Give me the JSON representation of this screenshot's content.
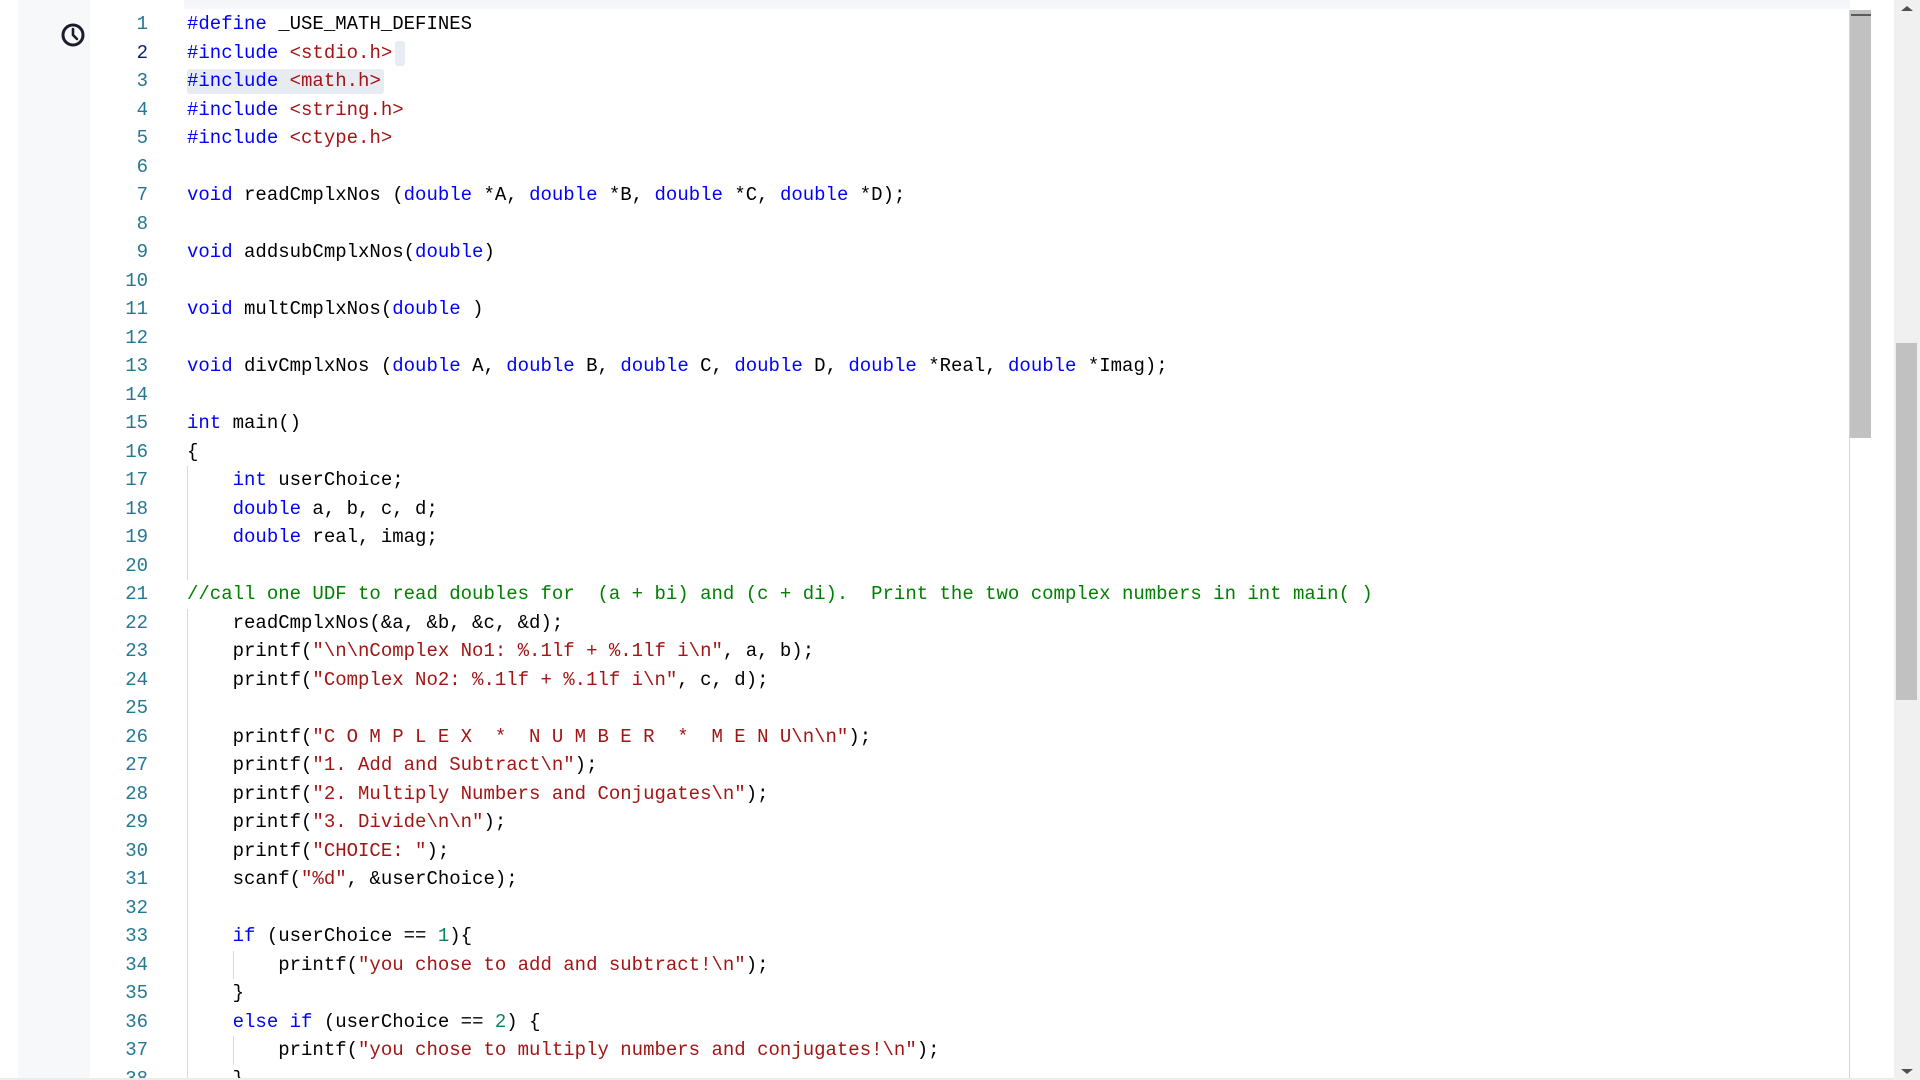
{
  "sidebar": {
    "icon": "clock-icon"
  },
  "editor": {
    "active_line": 2,
    "highlighted_line": 3,
    "colors": {
      "keyword": "#0000ff",
      "string": "#a31515",
      "comment": "#008000",
      "number": "#098658",
      "line_number": "#237893"
    },
    "lines": [
      [
        [
          "k",
          "#define"
        ],
        [
          "p",
          " _USE_MATH_DEFINES"
        ]
      ],
      [
        [
          "k",
          "#include"
        ],
        [
          "p",
          " "
        ],
        [
          "s",
          "<stdio.h>"
        ]
      ],
      [
        [
          "k",
          "#include"
        ],
        [
          "p",
          " "
        ],
        [
          "s",
          "<math.h>"
        ]
      ],
      [
        [
          "k",
          "#include"
        ],
        [
          "p",
          " "
        ],
        [
          "s",
          "<string.h>"
        ]
      ],
      [
        [
          "k",
          "#include"
        ],
        [
          "p",
          " "
        ],
        [
          "s",
          "<ctype.h>"
        ]
      ],
      [],
      [
        [
          "k",
          "void"
        ],
        [
          "p",
          " readCmplxNos ("
        ],
        [
          "k",
          "double"
        ],
        [
          "p",
          " *A, "
        ],
        [
          "k",
          "double"
        ],
        [
          "p",
          " *B, "
        ],
        [
          "k",
          "double"
        ],
        [
          "p",
          " *C, "
        ],
        [
          "k",
          "double"
        ],
        [
          "p",
          " *D);"
        ]
      ],
      [],
      [
        [
          "k",
          "void"
        ],
        [
          "p",
          " addsubCmplxNos("
        ],
        [
          "k",
          "double"
        ],
        [
          "p",
          ")"
        ]
      ],
      [],
      [
        [
          "k",
          "void"
        ],
        [
          "p",
          " multCmplxNos("
        ],
        [
          "k",
          "double"
        ],
        [
          "p",
          " )"
        ]
      ],
      [],
      [
        [
          "k",
          "void"
        ],
        [
          "p",
          " divCmplxNos ("
        ],
        [
          "k",
          "double"
        ],
        [
          "p",
          " A, "
        ],
        [
          "k",
          "double"
        ],
        [
          "p",
          " B, "
        ],
        [
          "k",
          "double"
        ],
        [
          "p",
          " C, "
        ],
        [
          "k",
          "double"
        ],
        [
          "p",
          " D, "
        ],
        [
          "k",
          "double"
        ],
        [
          "p",
          " *Real, "
        ],
        [
          "k",
          "double"
        ],
        [
          "p",
          " *Imag);"
        ]
      ],
      [],
      [
        [
          "k",
          "int"
        ],
        [
          "p",
          " main()"
        ]
      ],
      [
        [
          "p",
          "{"
        ]
      ],
      [
        [
          "p",
          "    "
        ],
        [
          "k",
          "int"
        ],
        [
          "p",
          " userChoice;"
        ]
      ],
      [
        [
          "p",
          "    "
        ],
        [
          "k",
          "double"
        ],
        [
          "p",
          " a, b, c, d;"
        ]
      ],
      [
        [
          "p",
          "    "
        ],
        [
          "k",
          "double"
        ],
        [
          "p",
          " real, imag;"
        ]
      ],
      [],
      [
        [
          "c",
          "//call one UDF to read doubles for  (a + bi) and (c + di).  Print the two complex numbers in int main( )"
        ]
      ],
      [
        [
          "p",
          "    readCmplxNos(&a, &b, &c, &d);"
        ]
      ],
      [
        [
          "p",
          "    printf("
        ],
        [
          "s",
          "\"\\n\\nComplex No1: %.1lf + %.1lf i\\n\""
        ],
        [
          "p",
          ", a, b);"
        ]
      ],
      [
        [
          "p",
          "    printf("
        ],
        [
          "s",
          "\"Complex No2: %.1lf + %.1lf i\\n\""
        ],
        [
          "p",
          ", c, d);"
        ]
      ],
      [],
      [
        [
          "p",
          "    printf("
        ],
        [
          "s",
          "\"C O M P L E X  *  N U M B E R  *  M E N U\\n\\n\""
        ],
        [
          "p",
          ");"
        ]
      ],
      [
        [
          "p",
          "    printf("
        ],
        [
          "s",
          "\"1. Add and Subtract\\n\""
        ],
        [
          "p",
          ");"
        ]
      ],
      [
        [
          "p",
          "    printf("
        ],
        [
          "s",
          "\"2. Multiply Numbers and Conjugates\\n\""
        ],
        [
          "p",
          ");"
        ]
      ],
      [
        [
          "p",
          "    printf("
        ],
        [
          "s",
          "\"3. Divide\\n\\n\""
        ],
        [
          "p",
          ");"
        ]
      ],
      [
        [
          "p",
          "    printf("
        ],
        [
          "s",
          "\"CHOICE: \""
        ],
        [
          "p",
          ");"
        ]
      ],
      [
        [
          "p",
          "    scanf("
        ],
        [
          "s",
          "\"%d\""
        ],
        [
          "p",
          ", &userChoice);"
        ]
      ],
      [],
      [
        [
          "p",
          "    "
        ],
        [
          "k",
          "if"
        ],
        [
          "p",
          " (userChoice == "
        ],
        [
          "n",
          "1"
        ],
        [
          "p",
          "){"
        ]
      ],
      [
        [
          "p",
          "        printf("
        ],
        [
          "s",
          "\"you chose to add and subtract!\\n\""
        ],
        [
          "p",
          ");"
        ]
      ],
      [
        [
          "p",
          "    }"
        ]
      ],
      [
        [
          "p",
          "    "
        ],
        [
          "k",
          "else"
        ],
        [
          "p",
          " "
        ],
        [
          "k",
          "if"
        ],
        [
          "p",
          " (userChoice == "
        ],
        [
          "n",
          "2"
        ],
        [
          "p",
          ") {"
        ]
      ],
      [
        [
          "p",
          "        printf("
        ],
        [
          "s",
          "\"you chose to multiply numbers and conjugates!\\n\""
        ],
        [
          "p",
          ");"
        ]
      ],
      [
        [
          "p",
          "    }"
        ]
      ]
    ]
  },
  "scrollbars": {
    "editor_position": 0,
    "page_position": 0.33
  }
}
